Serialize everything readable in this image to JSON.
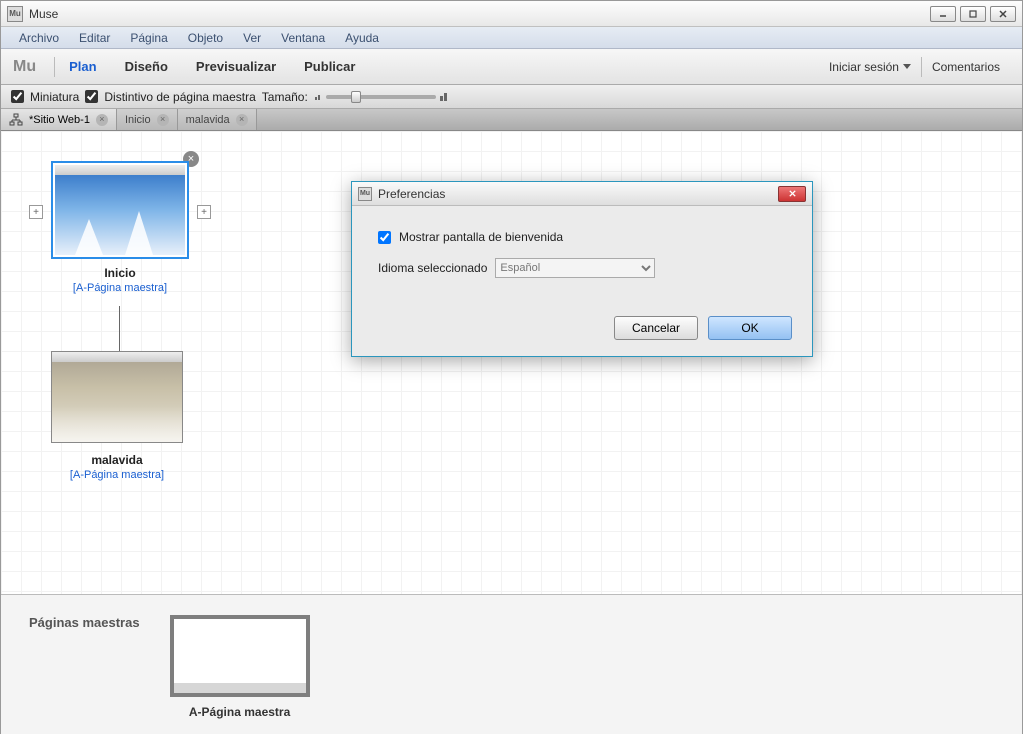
{
  "window": {
    "title": "Muse"
  },
  "menubar": [
    "Archivo",
    "Editar",
    "Página",
    "Objeto",
    "Ver",
    "Ventana",
    "Ayuda"
  ],
  "modebar": {
    "logo": "Mu",
    "modes": [
      "Plan",
      "Diseño",
      "Previsualizar",
      "Publicar"
    ],
    "active": 0,
    "login": "Iniciar sesión",
    "comments": "Comentarios"
  },
  "optsbar": {
    "thumb_label": "Miniatura",
    "master_label": "Distintivo de página maestra",
    "size_label": "Tamaño:"
  },
  "tabs": [
    {
      "label": "*Sitio Web-1",
      "site": true
    },
    {
      "label": "Inicio"
    },
    {
      "label": "malavida"
    }
  ],
  "pages": [
    {
      "name": "Inicio",
      "master": "[A-Página maestra]"
    },
    {
      "name": "malavida",
      "master": "[A-Página maestra]"
    }
  ],
  "masters": {
    "heading": "Páginas maestras",
    "items": [
      {
        "name": "A-Página maestra"
      }
    ]
  },
  "dialog": {
    "title": "Preferencias",
    "welcome_label": "Mostrar pantalla de bienvenida",
    "lang_label": "Idioma seleccionado",
    "lang_value": "Español",
    "cancel": "Cancelar",
    "ok": "OK"
  }
}
